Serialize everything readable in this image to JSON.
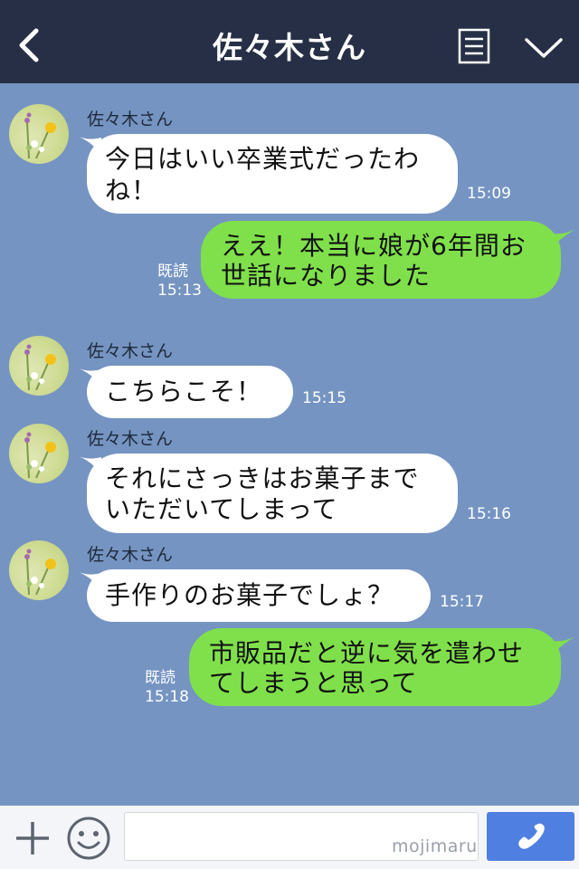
{
  "header": {
    "title": "佐々木さん",
    "back_icon": "chevron-left-icon",
    "menu_icon": "menu-lines-icon",
    "dropdown_icon": "chevron-down-icon",
    "bg_color": "#262f45"
  },
  "chat": {
    "bg_color": "#7594c2",
    "messages": [
      {
        "direction": "in",
        "sender": "佐々木さん",
        "lines": [
          "今日はいい卒業式だったわ",
          "ね！"
        ],
        "time": "15:09"
      },
      {
        "direction": "out",
        "read": "既読",
        "lines": [
          "ええ！本当に娘が6年間お",
          "世話になりました"
        ],
        "time": "15:13"
      },
      {
        "direction": "in",
        "sender": "佐々木さん",
        "lines": [
          "こちらこそ！"
        ],
        "time": "15:15"
      },
      {
        "direction": "in",
        "sender": "佐々木さん",
        "lines": [
          "それにさっきはお菓子まで",
          "いただいてしまって"
        ],
        "time": "15:16"
      },
      {
        "direction": "in",
        "sender": "佐々木さん",
        "lines": [
          "手作りのお菓子でしょ？"
        ],
        "time": "15:17"
      },
      {
        "direction": "out",
        "read": "既読",
        "lines": [
          "市販品だと逆に気を遣わせ",
          "てしまうと思って"
        ],
        "time": "15:18"
      }
    ]
  },
  "bottom_bar": {
    "plus_icon": "plus-icon",
    "sticker_icon": "smiley-icon",
    "input_value": "",
    "watermark": "mojimaru",
    "call_icon": "phone-icon",
    "call_color": "#4f7fe0"
  }
}
